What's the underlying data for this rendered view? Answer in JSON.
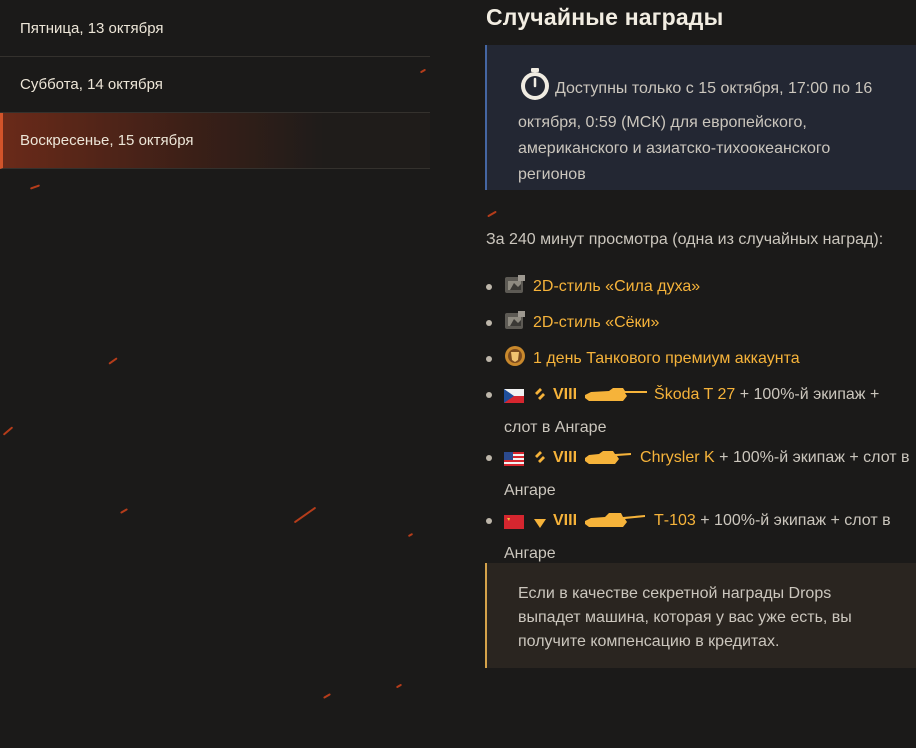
{
  "days": [
    {
      "label": "Пятница, 13 октября",
      "active": false
    },
    {
      "label": "Суббота, 14 октября",
      "active": false
    },
    {
      "label": "Воскресенье, 15 октября",
      "active": true
    }
  ],
  "section_title": "Случайные награды",
  "availability_notice": "Доступны только с 15 октября, 17:00 по 16 октября, 0:59 (МСК) для европейского, американского и азиатско-тихоокеанского регионов",
  "watch_intro": "За 240 минут просмотра (одна из случайных наград):",
  "rewards": [
    {
      "icon": "2d-style-icon",
      "name": "2D-стиль «Сила духа»"
    },
    {
      "icon": "2d-style-icon",
      "name": "2D-стиль «Сёки»"
    },
    {
      "icon": "premium-account-icon",
      "name": "1 день Танкового премиум аккаунта"
    }
  ],
  "tanks": [
    {
      "flag": "czech-flag-icon",
      "class": "medium-tank-icon",
      "tier": "VIII",
      "name": "Škoda T 27",
      "extra": " + 100%-й экипаж + слот в Ангаре"
    },
    {
      "flag": "usa-flag-icon",
      "class": "medium-tank-icon",
      "tier": "VIII",
      "name": "Chrysler K",
      "extra": " + 100%-й экипаж + слот в Ангаре"
    },
    {
      "flag": "ussr-flag-icon",
      "class": "heavy-tank-icon",
      "tier": "VIII",
      "name": "Т-103",
      "extra": " + 100%-й экипаж + слот в Ангаре"
    }
  ],
  "compensation_note": "Если в качестве секретной награды Drops выпадет машина, которая у вас уже есть, вы получите компенсацию в кредитах.",
  "colors": {
    "accent": "#f6b33a",
    "active_day": "#d2542a",
    "notice_border": "#4566a2",
    "warn_border": "#d4a24a"
  }
}
